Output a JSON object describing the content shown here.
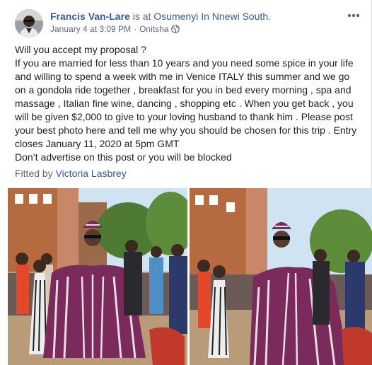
{
  "post": {
    "author": "Francis Van-Lare",
    "is_at": " is at ",
    "location": "Osumenyi In Nnewi South.",
    "timestamp": "January 4 at 3:09 PM",
    "separator": "·",
    "place": "Onitsha",
    "privacy_icon": "globe-icon",
    "more_icon": "ellipsis-icon",
    "lines": [
      "Will you accept my proposal ?",
      "If you are married for less than 10 years and you need some spice in your life and willing to spend a week with me in Venice ITALY this summer and we go on a gondola ride together , breakfast for you in bed every morning , spa and massage , Italian fine wine, dancing , shopping etc . When you get back , you will be given $2,000 to give to your loving husband to thank him . Please post your best photo here and tell me why you should be chosen for this trip . Entry closes January 11, 2020 at 5pm GMT",
      "Don’t advertise on this post or you will be blocked"
    ],
    "fitted_by": "Fitted by ",
    "fitted_name": "Victoria Lasbrey"
  },
  "colors": {
    "link": "#385898",
    "secondary_text": "#616770",
    "robe_purple": "#7b2a5c",
    "sky": "#cfe3f2"
  }
}
